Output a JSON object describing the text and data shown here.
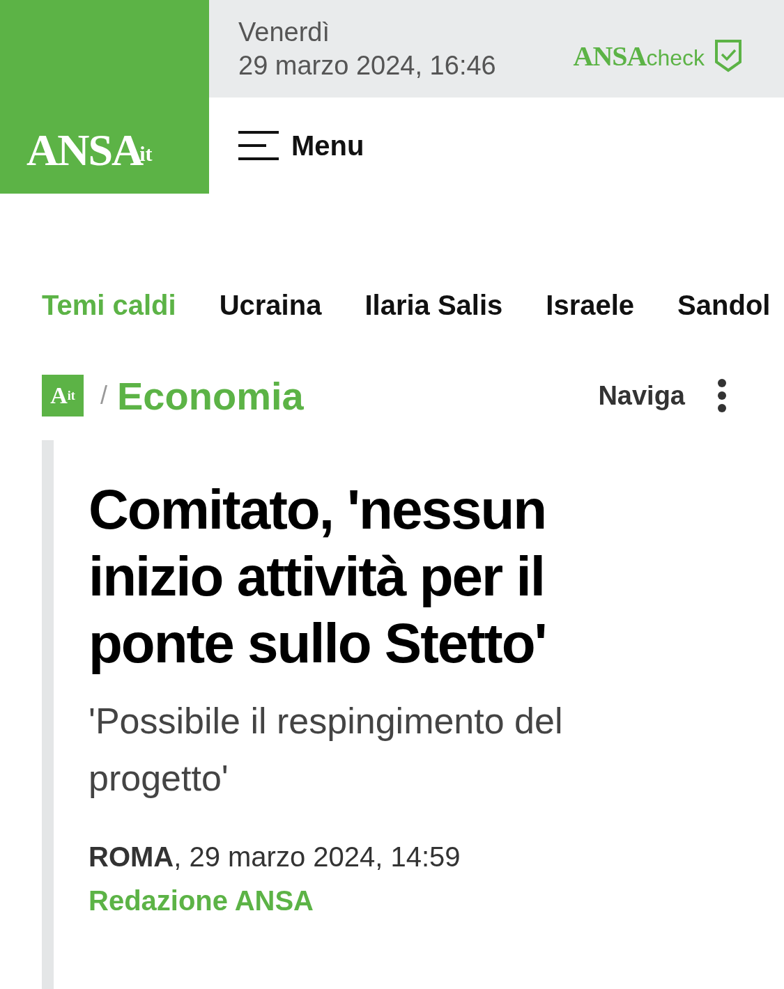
{
  "header": {
    "logo": {
      "main": "ANSA",
      "suffix": "it"
    },
    "date": {
      "weekday": "Venerdì",
      "datetime": "29 marzo 2024, 16:46"
    },
    "check_logo": {
      "main": "ANSA",
      "suffix": "check"
    },
    "menu_label": "Menu"
  },
  "topics": [
    {
      "label": "Temi caldi",
      "kind": "heading"
    },
    {
      "label": "Ucraina",
      "kind": "link"
    },
    {
      "label": "Ilaria Salis",
      "kind": "link"
    },
    {
      "label": "Israele",
      "kind": "link"
    },
    {
      "label": "Sandol",
      "kind": "link"
    }
  ],
  "breadcrumb": {
    "logo": {
      "main": "A",
      "suffix": "it"
    },
    "separator": "/",
    "section": "Economia",
    "navigate": "Naviga"
  },
  "article": {
    "title": "Comitato, 'nessun inizio attività per il ponte sullo Stetto'",
    "subtitle": "'Possibile il respingimento del progetto'",
    "place": "ROMA",
    "date": ", 29 marzo 2024, 14:59",
    "author": "Redazione ANSA"
  }
}
